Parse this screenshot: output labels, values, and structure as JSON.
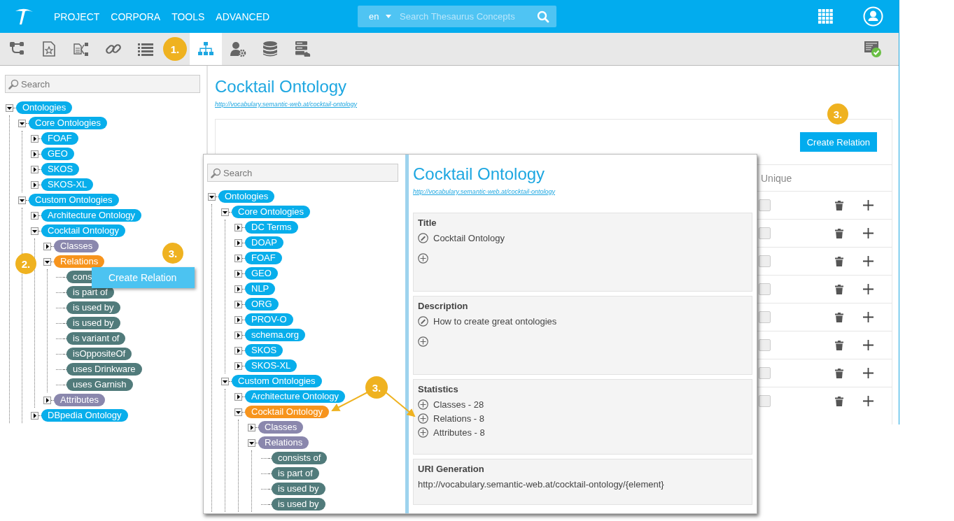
{
  "topbar": {
    "nav": [
      "PROJECT",
      "CORPORA",
      "TOOLS",
      "ADVANCED"
    ],
    "language": "en",
    "search": {
      "placeholder": "Search Thesaurus Concepts"
    }
  },
  "toolbar": {
    "tools": [
      {
        "kind": "hierarchy"
      },
      {
        "kind": "starred-doc"
      },
      {
        "kind": "doc-branch"
      },
      {
        "kind": "link"
      },
      {
        "kind": "list"
      }
    ],
    "step_badge": "1.",
    "views": [
      {
        "kind": "sitemap",
        "selected": true
      },
      {
        "kind": "user-gear",
        "selected": false
      },
      {
        "kind": "database",
        "selected": false
      },
      {
        "kind": "server-cloud",
        "selected": false
      }
    ]
  },
  "left": {
    "search": {
      "placeholder": "Search"
    },
    "tree": [
      {
        "label": "Ontologies",
        "kind": "ontology",
        "expanded": true,
        "selected": false,
        "children": [
          {
            "label": "Core Ontologies",
            "kind": "ontology",
            "expanded": true,
            "selected": false,
            "children": [
              {
                "label": "FOAF",
                "kind": "ontology",
                "expanded": false,
                "selected": false
              },
              {
                "label": "GEO",
                "kind": "ontology",
                "expanded": false,
                "selected": false
              },
              {
                "label": "SKOS",
                "kind": "ontology",
                "expanded": false,
                "selected": false
              },
              {
                "label": "SKOS-XL",
                "kind": "ontology",
                "expanded": false,
                "selected": false
              }
            ]
          },
          {
            "label": "Custom Ontologies",
            "kind": "ontology",
            "expanded": true,
            "selected": false,
            "children": [
              {
                "label": "Architecture Ontology",
                "kind": "ontology",
                "expanded": false,
                "selected": false
              },
              {
                "label": "Cocktail Ontology",
                "kind": "ontology",
                "expanded": true,
                "selected": false,
                "children": [
                  {
                    "label": "Classes",
                    "kind": "category",
                    "expanded": false,
                    "selected": false
                  },
                  {
                    "label": "Relations",
                    "kind": "category",
                    "expanded": true,
                    "selected": true,
                    "children": [
                      {
                        "label": "cons",
                        "kind": "relation",
                        "selected": false
                      },
                      {
                        "label": "is part of",
                        "kind": "relation",
                        "selected": false
                      },
                      {
                        "label": "is used by",
                        "kind": "relation",
                        "selected": false
                      },
                      {
                        "label": "is used by",
                        "kind": "relation",
                        "selected": false
                      },
                      {
                        "label": "is variant of",
                        "kind": "relation",
                        "selected": false
                      },
                      {
                        "label": "isOppositeOf",
                        "kind": "relation",
                        "selected": false
                      },
                      {
                        "label": "uses Drinkware",
                        "kind": "relation",
                        "selected": false
                      },
                      {
                        "label": "uses Garnish",
                        "kind": "relation",
                        "selected": false
                      }
                    ]
                  },
                  {
                    "label": "Attributes",
                    "kind": "category",
                    "expanded": false,
                    "selected": false
                  }
                ]
              },
              {
                "label": "DBpedia Ontology",
                "kind": "ontology",
                "expanded": false,
                "selected": false
              }
            ]
          }
        ]
      }
    ],
    "step_badges": [
      "2.",
      "3."
    ],
    "context_menu": {
      "items": [
        "Create Relation"
      ]
    }
  },
  "main": {
    "title": "Cocktail Ontology",
    "uri": "http://vocabulary.semantic-web.at/cocktail-ontology",
    "step_badge": "3.",
    "create_button": "Create Relation",
    "table": {
      "columns": [
        "Unique"
      ],
      "rows": [
        {
          "unique": false
        },
        {
          "unique": false
        },
        {
          "unique": false
        },
        {
          "unique": false
        },
        {
          "unique": false
        },
        {
          "unique": false
        },
        {
          "unique": false
        },
        {
          "unique": false
        }
      ]
    }
  },
  "inset": {
    "search": {
      "placeholder": "Search"
    },
    "tree": [
      {
        "label": "Ontologies",
        "kind": "ontology",
        "expanded": true,
        "selected": false,
        "children": [
          {
            "label": "Core Ontologies",
            "kind": "ontology",
            "expanded": true,
            "selected": false,
            "children": [
              {
                "label": "DC Terms",
                "kind": "ontology",
                "expanded": false,
                "selected": false
              },
              {
                "label": "DOAP",
                "kind": "ontology",
                "expanded": false,
                "selected": false
              },
              {
                "label": "FOAF",
                "kind": "ontology",
                "expanded": false,
                "selected": false
              },
              {
                "label": "GEO",
                "kind": "ontology",
                "expanded": false,
                "selected": false
              },
              {
                "label": "NLP",
                "kind": "ontology",
                "expanded": false,
                "selected": false
              },
              {
                "label": "ORG",
                "kind": "ontology",
                "expanded": false,
                "selected": false
              },
              {
                "label": "PROV-O",
                "kind": "ontology",
                "expanded": false,
                "selected": false
              },
              {
                "label": "schema.org",
                "kind": "ontology",
                "expanded": false,
                "selected": false
              },
              {
                "label": "SKOS",
                "kind": "ontology",
                "expanded": false,
                "selected": false
              },
              {
                "label": "SKOS-XL",
                "kind": "ontology",
                "expanded": false,
                "selected": false
              }
            ]
          },
          {
            "label": "Custom Ontologies",
            "kind": "ontology",
            "expanded": true,
            "selected": false,
            "children": [
              {
                "label": "Architecture Ontology",
                "kind": "ontology",
                "expanded": false,
                "selected": false
              },
              {
                "label": "Cocktail Ontology",
                "kind": "ontology",
                "expanded": true,
                "selected": true,
                "children": [
                  {
                    "label": "Classes",
                    "kind": "category",
                    "expanded": false,
                    "selected": false
                  },
                  {
                    "label": "Relations",
                    "kind": "category",
                    "expanded": true,
                    "selected": false,
                    "children": [
                      {
                        "label": "consists of",
                        "kind": "relation",
                        "selected": false
                      },
                      {
                        "label": "is part of",
                        "kind": "relation",
                        "selected": false
                      },
                      {
                        "label": "is used by",
                        "kind": "relation",
                        "selected": false
                      },
                      {
                        "label": "is used by",
                        "kind": "relation",
                        "selected": false
                      }
                    ]
                  }
                ]
              }
            ]
          }
        ]
      }
    ],
    "step_badge": "3.",
    "detail": {
      "title": "Cocktail Ontology",
      "uri": "http://vocabulary.semantic-web.at/cocktail-ontology",
      "sections": [
        {
          "heading": "Title",
          "kind": "editable",
          "items": [
            "Cocktail Ontology"
          ]
        },
        {
          "heading": "Description",
          "kind": "editable",
          "items": [
            "How to create great ontologies"
          ]
        },
        {
          "heading": "Statistics",
          "kind": "stats",
          "items": [
            "Classes - 28",
            "Relations - 8",
            "Attributes - 8"
          ]
        },
        {
          "heading": "URI Generation",
          "kind": "text",
          "items": [
            "http://vocabulary.semantic-web.at/cocktail-ontology/{element}"
          ]
        }
      ]
    }
  }
}
